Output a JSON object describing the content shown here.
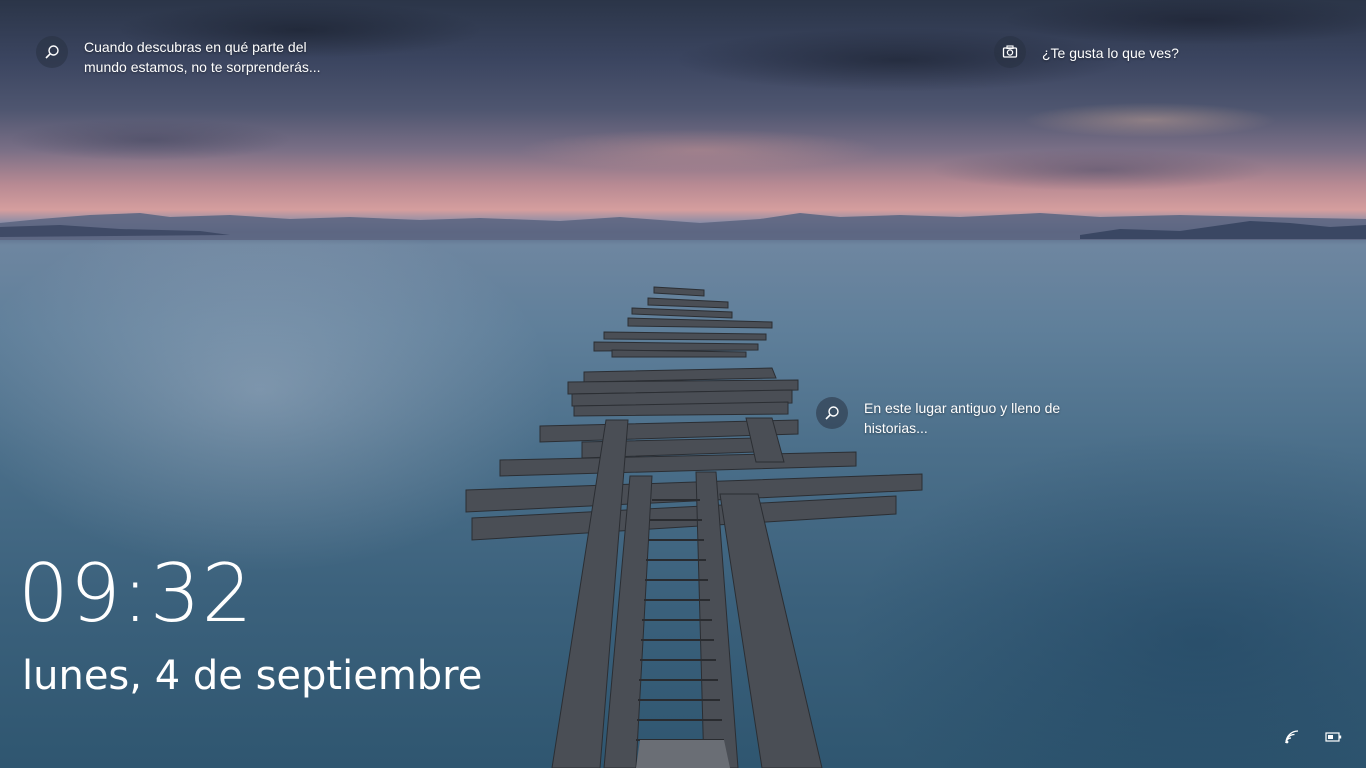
{
  "lockscreen": {
    "hotspot_top_left": {
      "icon": "search-icon",
      "line1": "Cuando descubras en qué parte del",
      "line2": "mundo estamos, no te sorprenderás..."
    },
    "hotspot_top_right": {
      "icon": "camera-icon",
      "line1": "¿Te gusta lo que ves?"
    },
    "hotspot_middle": {
      "icon": "search-icon",
      "line1": "En este lugar antiguo y lleno de",
      "line2": "historias..."
    },
    "clock": {
      "time": "09:32",
      "date": "lunes, 4 de septiembre"
    },
    "tray": {
      "network_icon": "wifi-icon",
      "battery_icon": "battery-icon"
    }
  }
}
